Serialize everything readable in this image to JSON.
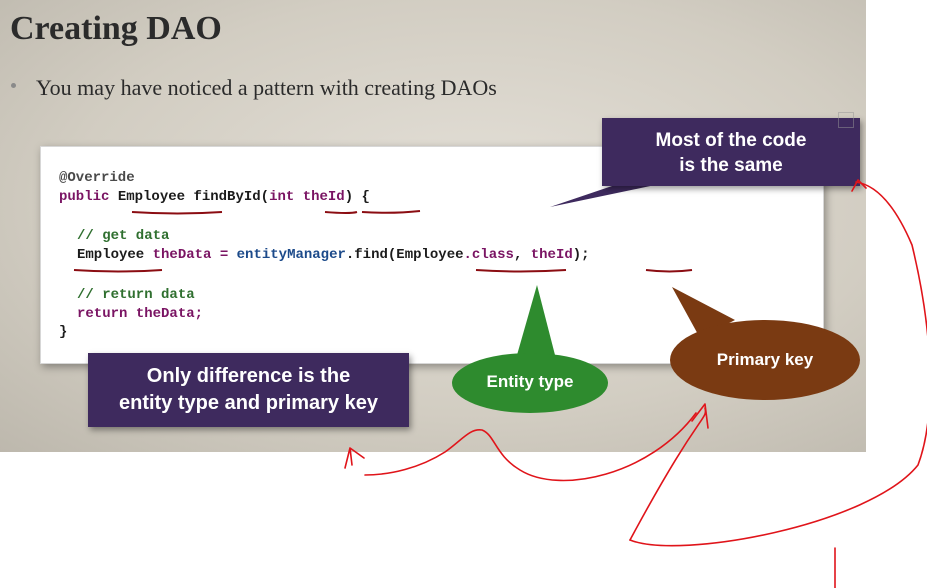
{
  "slide": {
    "title": "Creating DAO",
    "bullet": "You may have noticed a pattern with creating DAOs"
  },
  "code": {
    "line1": "@Override",
    "line2_kw1": "public",
    "line2_type": "Employee",
    "line2_method": "findById(",
    "line2_kw2": "int",
    "line2_param": "theId",
    "line2_end": ") {",
    "line3": "// get data",
    "line4_type": "Employee",
    "line4_var": "theData =",
    "line4_obj": "entityManager",
    "line4_call": ".find(",
    "line4_class": "Employee",
    "line4_dotclass": ".class",
    "line4_comma": ",",
    "line4_param": "theId",
    "line4_end": ");",
    "line5": "// return data",
    "line6_kw": "return",
    "line6_rest": "theData;",
    "line7": "}"
  },
  "callouts": {
    "same_line1": "Most of the code",
    "same_line2": "is the same",
    "difference_line1": "Only difference is the",
    "difference_line2": "entity type and primary key",
    "entity_type": "Entity type",
    "primary_key": "Primary key"
  },
  "colors": {
    "callout_purple": "#3e2a5e",
    "entity_green": "#2e8b2e",
    "primary_brown": "#7a3a12",
    "annotation_red": "#e0141a"
  }
}
